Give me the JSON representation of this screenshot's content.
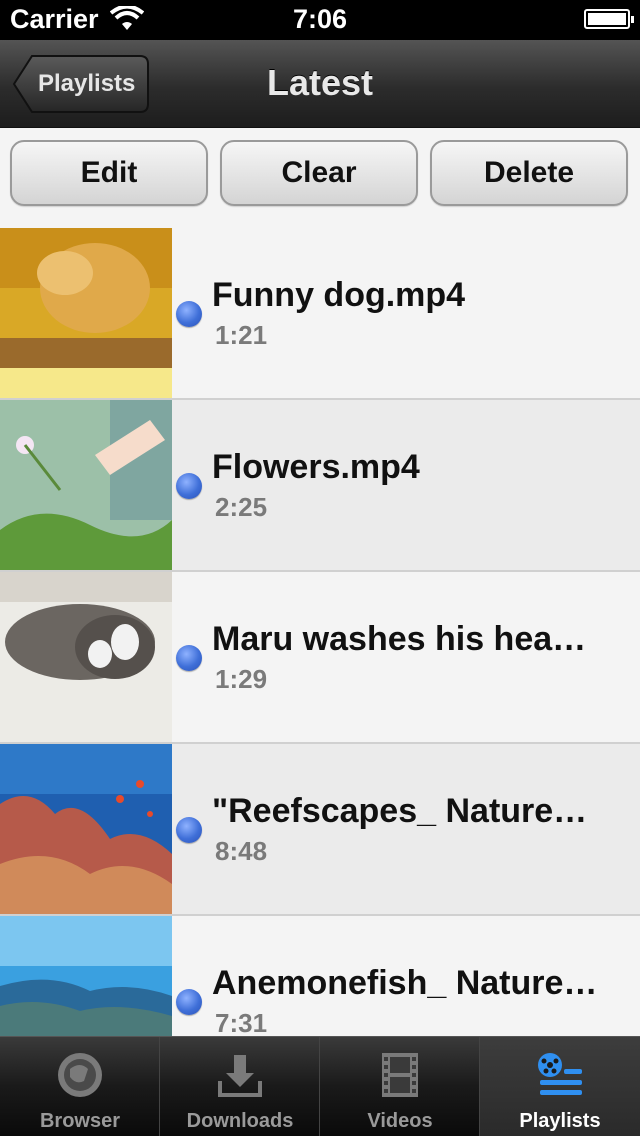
{
  "status_bar": {
    "carrier": "Carrier",
    "time": "7:06"
  },
  "nav": {
    "back_label": "Playlists",
    "title": "Latest"
  },
  "toolbar": {
    "edit": "Edit",
    "clear": "Clear",
    "delete": "Delete"
  },
  "videos": [
    {
      "title": "Funny dog.mp4",
      "duration": "1:21"
    },
    {
      "title": "Flowers.mp4",
      "duration": "2:25"
    },
    {
      "title": "Maru washes his hea…",
      "duration": "1:29"
    },
    {
      "title": "\"Reefscapes_ Nature…",
      "duration": "8:48"
    },
    {
      "title": "Anemonefish_ Nature…",
      "duration": "7:31"
    }
  ],
  "tabs": [
    {
      "label": "Browser",
      "icon": "browser-icon",
      "active": false
    },
    {
      "label": "Downloads",
      "icon": "download-icon",
      "active": false
    },
    {
      "label": "Videos",
      "icon": "film-icon",
      "active": false
    },
    {
      "label": "Playlists",
      "icon": "playlist-icon",
      "active": true
    }
  ],
  "colors": {
    "unwatched_dot": "#3f6fd8",
    "active_tab_icon": "#2f8ff0"
  }
}
